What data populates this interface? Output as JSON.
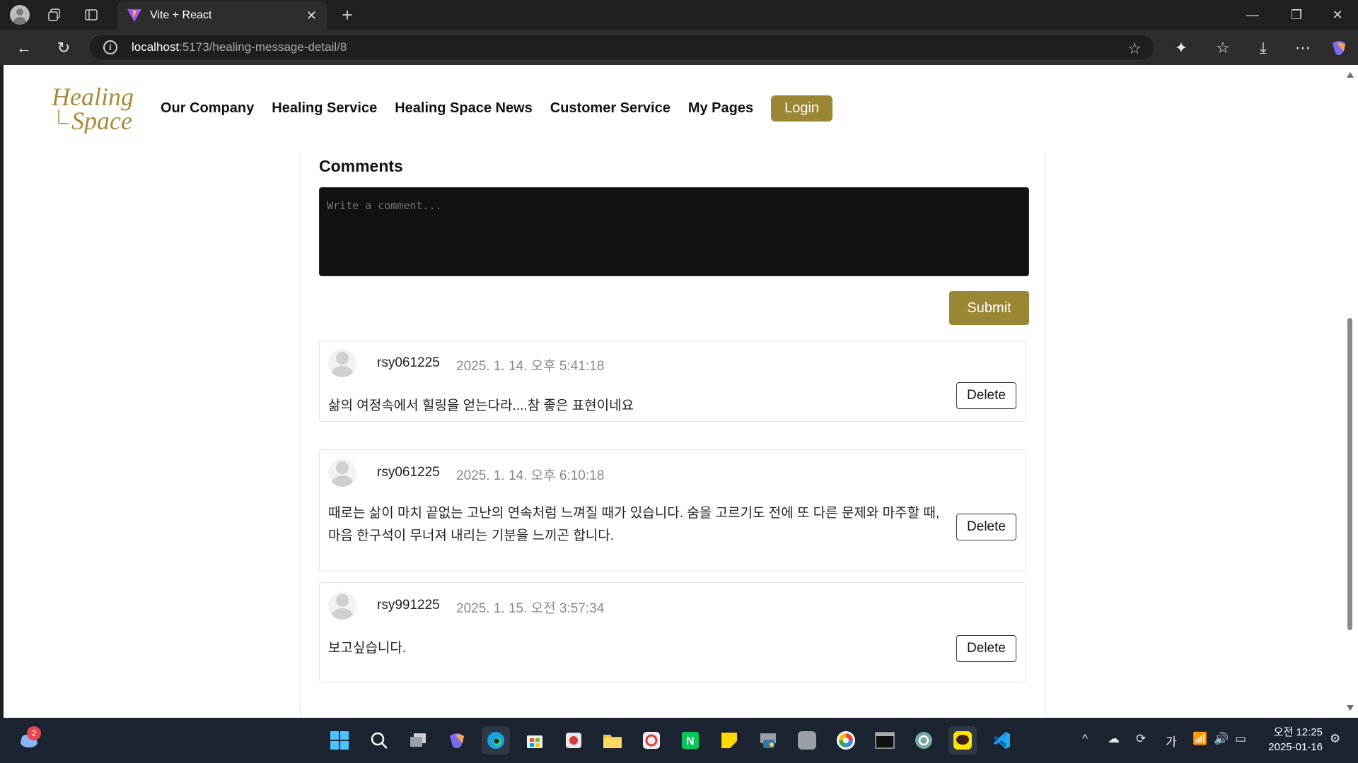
{
  "browser": {
    "tab_title": "Vite + React",
    "url_host": "localhost",
    "url_rest": ":5173/healing-message-detail/8"
  },
  "site": {
    "logo_line1": "Healing",
    "logo_line2": "Space",
    "menu": [
      "Our Company",
      "Healing Service",
      "Healing Space News",
      "Customer Service",
      "My Pages"
    ],
    "login_label": "Login",
    "accent_color": "#9a8633"
  },
  "comments": {
    "title": "Comments",
    "placeholder": "Write a comment...",
    "submit_label": "Submit",
    "delete_label": "Delete",
    "items": [
      {
        "user": "rsy061225",
        "date": "2025. 1. 14. 오후 5:41:18",
        "text": "삶의 여정속에서 힐링을 얻는다라....참 좋은 표현이네요"
      },
      {
        "user": "rsy061225",
        "date": "2025. 1. 14. 오후 6:10:18",
        "text": "때로는 삶이 마치 끝없는 고난의 연속처럼 느껴질 때가 있습니다. 숨을 고르기도 전에 또 다른 문제와 마주할 때, 마음 한구석이 무너져 내리는 기분을 느끼곤 합니다."
      },
      {
        "user": "rsy991225",
        "date": "2025. 1. 15. 오전 3:57:34",
        "text": "보고싶습니다."
      }
    ]
  },
  "taskbar": {
    "weather_badge": "2",
    "ime": "가",
    "time": "오전 12:25",
    "date": "2025-01-16"
  }
}
